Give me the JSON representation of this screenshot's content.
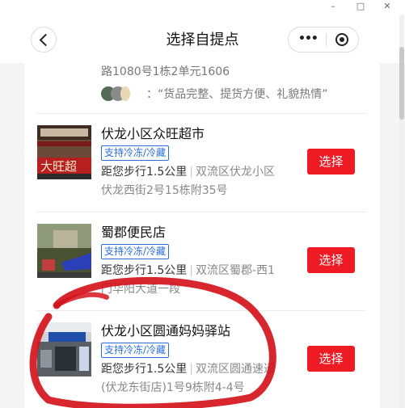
{
  "window": {
    "minimize_glyph": "–",
    "maximize_glyph": "□",
    "close_glyph": "✕"
  },
  "header": {
    "title": "选择自提点",
    "more_icon": "more-dots-icon",
    "close_icon": "target-icon",
    "back_icon": "chevron-left-icon"
  },
  "partial_store": {
    "address_tail": "路1080号1栋2单元1606",
    "review_text": "：“货品完整、提货方便、礼貌热情”"
  },
  "stores": [
    {
      "name": "伏龙小区众旺超市",
      "tag": "支持冷冻/冷藏",
      "distance": "距您步行1.5公里",
      "address_line1": "双流区伏龙小区",
      "address_line2": "伏龙西街2号15栋附35号",
      "button": "选择"
    },
    {
      "name": "蜀郡便民店",
      "tag": "支持冷冻/冷藏",
      "distance": "距您步行1.5公里",
      "address_line1": "双流区蜀郡-西1",
      "address_line2": "门华阳大道一段",
      "button": "选择"
    },
    {
      "name": "伏龙小区圆通妈妈驿站",
      "tag": "支持冷冻/冷藏",
      "distance": "距您步行1.5公里",
      "address_line1": "双流区圆通速递",
      "address_line2": "(伏龙东街店)1号9栋附4-4号",
      "button": "选择"
    }
  ],
  "colors": {
    "accent_red": "#ee1b24",
    "tag_blue": "#2b6fd6",
    "annotation_red": "#d4141c"
  }
}
